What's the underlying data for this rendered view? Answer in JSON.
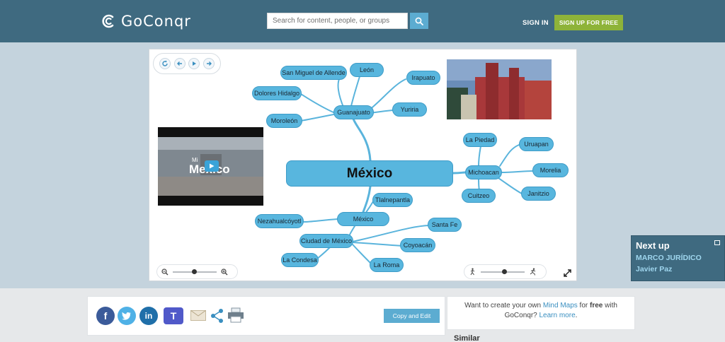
{
  "header": {
    "logo_text": "GoConqr",
    "search_placeholder": "Search for content, people, or groups",
    "signin_label": "SIGN IN",
    "signup_label": "SIGN UP FOR FREE"
  },
  "mindmap": {
    "central": "México",
    "nodes": {
      "guanajuato": "Guanajuato",
      "san_miguel": "San Miguel de Allende",
      "leon": "León",
      "dolores": "Dolores Hidalgo",
      "moroleon": "Moroleón",
      "irapuato": "Irapuato",
      "yuriria": "Yuriria",
      "michoacan": "Michoacan",
      "la_piedad": "La Piedad",
      "uruapan": "Uruapan",
      "morelia": "Morelia",
      "janitzio": "Janitzio",
      "cuitzeo": "Cuitzeo",
      "mexico": "México",
      "tlalnepantla": "Tlalnepantla",
      "nezahualcoyotl": "Nezahualcóyotl",
      "cdmx": "Ciudad de México",
      "santa_fe": "Santa Fe",
      "coyoacan": "Coyoacán",
      "la_condesa": "La Condesa",
      "la_roma": "La Roma"
    },
    "video_caption_top": "Mi",
    "video_caption_main": "Mexico"
  },
  "next_up": {
    "title": "Next up",
    "items": [
      "MARCO JURÍDICO",
      "Javier Paz"
    ]
  },
  "share": {
    "networks": [
      "facebook-icon",
      "twitter-icon",
      "linkedin-icon",
      "teams-icon",
      "email-icon",
      "share-icon",
      "print-icon"
    ],
    "copy_edit_label": "Copy and Edit"
  },
  "create": {
    "line_pre": "Want to create your own ",
    "link_mindmaps": "Mind Maps",
    "line_mid": " for ",
    "bold_free": "free",
    "line_post": " with",
    "line2_pre": "GoConqr? ",
    "link_learn": "Learn more",
    "line2_post": "."
  },
  "similar_label": "Similar",
  "colors": {
    "header_bg": "#3f6a80",
    "node_fill": "#58b6de",
    "accent_green": "#8eb339",
    "accent_blue": "#5cacd1"
  }
}
